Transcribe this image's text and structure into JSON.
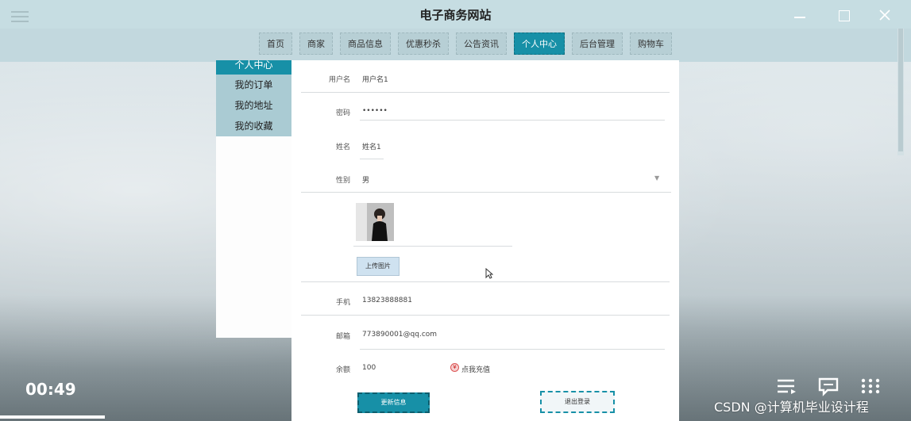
{
  "window": {
    "title": "电子商务网站"
  },
  "nav": {
    "tabs": [
      {
        "label": "首页"
      },
      {
        "label": "商家"
      },
      {
        "label": "商品信息"
      },
      {
        "label": "优惠秒杀"
      },
      {
        "label": "公告资讯"
      },
      {
        "label": "个人中心",
        "active": true
      },
      {
        "label": "后台管理"
      },
      {
        "label": "购物车"
      }
    ],
    "active_color": "#1790a7"
  },
  "sidebar": {
    "items": [
      {
        "label": "个人中心",
        "active": true
      },
      {
        "label": "我的订单"
      },
      {
        "label": "我的地址"
      },
      {
        "label": "我的收藏"
      }
    ]
  },
  "form": {
    "username": {
      "label": "用户名",
      "value": "用户名1"
    },
    "password": {
      "label": "密码",
      "value": "••••••"
    },
    "name": {
      "label": "姓名",
      "value": "姓名1"
    },
    "gender": {
      "label": "性别",
      "value": "男"
    },
    "upload_label": "上传图片",
    "phone": {
      "label": "手机",
      "value": "13823888881"
    },
    "email": {
      "label": "邮箱",
      "value": "773890001@qq.com"
    },
    "balance": {
      "label": "余额",
      "value": "100"
    },
    "recharge_label": "点我充值",
    "update_label": "更新信息",
    "logout_label": "退出登录"
  },
  "video": {
    "timestamp": "00:49",
    "progress": 0.115
  },
  "watermark": "CSDN @计算机毕业设计程"
}
